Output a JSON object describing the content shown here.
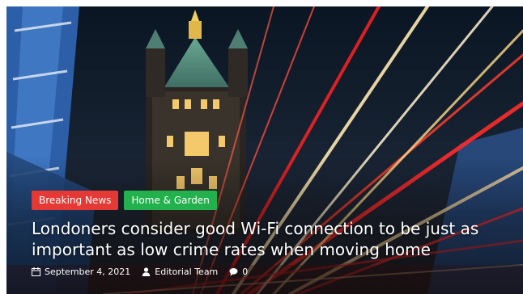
{
  "post": {
    "categories": [
      {
        "label": "Breaking News",
        "color": "#e53935"
      },
      {
        "label": "Home & Garden",
        "color": "#22b14c"
      }
    ],
    "title": "Londoners consider good Wi-Fi connection to be just as important as low crime rates when moving home",
    "date": "September 4, 2021",
    "author": "Editorial Team",
    "comments": "0",
    "icons": [
      "calendar-icon",
      "user-icon",
      "comment-icon"
    ]
  }
}
